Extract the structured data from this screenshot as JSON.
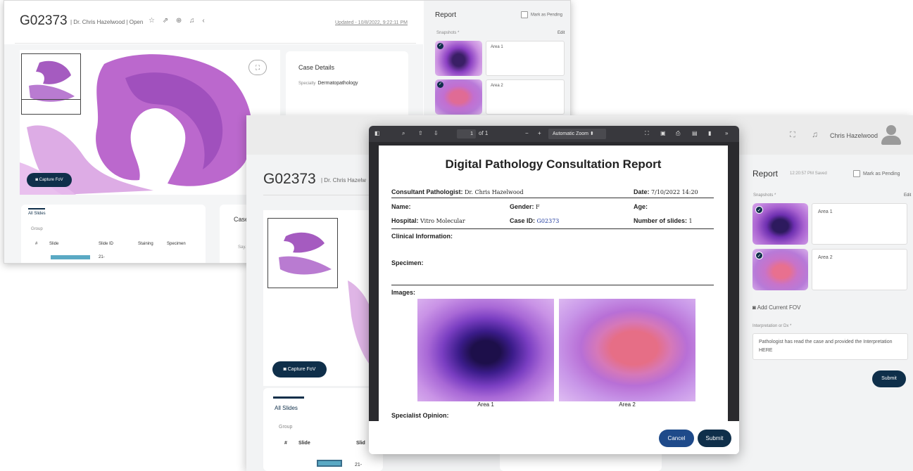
{
  "back_window": {
    "case_id": "G02373",
    "header_meta": "| Dr. Chris Hazelwood | Open",
    "header_icons": "☆ ⇗ ⊕ ♫ ‹",
    "updated": "Updated - 10/8/2022, 9:22:11 PM",
    "capture_label": "Capture FoV",
    "case_details_title": "Case Details",
    "specialty_label": "Specialty",
    "specialty_value": "Dermatopathology",
    "all_slides_tab": "All Slides",
    "group_label": "Group",
    "columns": [
      "#",
      "Slide",
      "Slide ID",
      "Staining",
      "Specimen"
    ],
    "row_partial_id": "21-",
    "case_card_partial": "Case",
    "case_card_placeholder": "Say...",
    "report": {
      "title": "Report",
      "mark_pending": "Mark as Pending",
      "snapshots_label": "Snapshots *",
      "edit_label": "Edit",
      "snapshots": [
        {
          "label": "Area 1"
        },
        {
          "label": "Area 2"
        }
      ]
    }
  },
  "front_window": {
    "topbar": {
      "user_name": "Chris Hazelwood",
      "expand_icon": "expand-icon",
      "bell_icon": "bell-icon"
    },
    "case_id": "G02373",
    "header_meta": "| Dr. Chris Hazelw",
    "capture_label": "Capture FoV",
    "all_slides_tab": "All Slides",
    "group_label": "Group",
    "columns": [
      "#",
      "Slide",
      "Slid"
    ],
    "row_id": "21-",
    "case_card_partial": "Case",
    "report": {
      "title": "Report",
      "saved": "12:20:57 PM Saved",
      "mark_pending": "Mark as Pending",
      "snapshots_label": "Snapshots *",
      "edit_label": "Edit",
      "snapshots": [
        {
          "label": "Area 1"
        },
        {
          "label": "Area 2"
        }
      ],
      "add_fov": "Add Current FOV",
      "interp_label": "Interpretation or Dx *",
      "interp_value": "Pathologist has read the case and provided the Interpretation HERE",
      "submit": "Submit"
    }
  },
  "pdf_modal": {
    "toolbar": {
      "page_current": "1",
      "page_total": "of 1",
      "zoom": "Automatic Zoom"
    },
    "document": {
      "title": "Digital Pathology Consultation Report",
      "consultant_label": "Consultant Pathologist:",
      "consultant_value": "Dr. Chris Hazelwood",
      "date_label": "Date:",
      "date_value": "7/10/2022   14:20",
      "name_label": "Name:",
      "gender_label": "Gender:",
      "gender_value": "F",
      "age_label": "Age:",
      "hospital_label": "Hospital:",
      "hospital_value": "Vitro Molecular",
      "case_id_label": "Case ID:",
      "case_id_value": "G02373",
      "slides_label": "Number of slides:",
      "slides_value": "1",
      "clinical_label": "Clinical Information:",
      "specimen_label": "Specimen:",
      "images_label": "Images:",
      "image_captions": [
        "Area 1",
        "Area 2"
      ],
      "opinion_label": "Specialist Opinion:"
    },
    "cancel": "Cancel",
    "submit": "Submit"
  },
  "colors": {
    "navy": "#0f2f4a",
    "cancel_blue": "#1e4a8a",
    "pdf_toolbar": "#38383d"
  }
}
